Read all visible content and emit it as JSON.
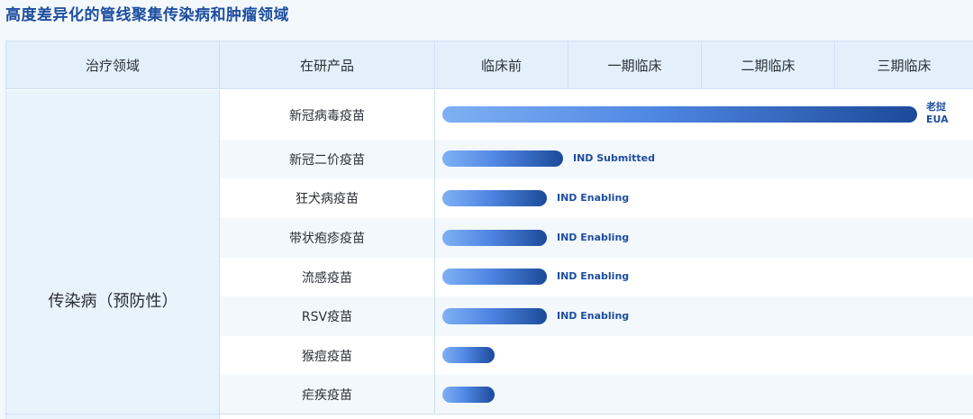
{
  "title": "高度差异化的管线聚集传染病和肿瘤领域",
  "headers": {
    "area": "治疗领域",
    "product": "在研产品",
    "stages": [
      "临床前",
      "一期临床",
      "二期临床",
      "三期临床"
    ]
  },
  "area_label": "传染病（预防性）",
  "rows": [
    {
      "product": "新冠病毒疫苗",
      "progress": 1.0,
      "status_line1": "老挝",
      "status_line2": "EUA"
    },
    {
      "product": "新冠二价疫苗",
      "progress": 0.25,
      "status": "IND Submitted"
    },
    {
      "product": "狂犬病疫苗",
      "progress": 0.22,
      "status": "IND Enabling"
    },
    {
      "product": "带状疱疹疫苗",
      "progress": 0.22,
      "status": "IND Enabling"
    },
    {
      "product": "流感疫苗",
      "progress": 0.22,
      "status": "IND Enabling"
    },
    {
      "product": "RSV疫苗",
      "progress": 0.22,
      "status": "IND Enabling"
    },
    {
      "product": "猴痘疫苗",
      "progress": 0.11
    },
    {
      "product": "疟疾疫苗",
      "progress": 0.11
    }
  ],
  "colors": {
    "header_bg": "#e3f0fc",
    "bar_start": "#7fb0f5",
    "bar_end": "#1c4a9a",
    "label": "#1d4e9e"
  }
}
